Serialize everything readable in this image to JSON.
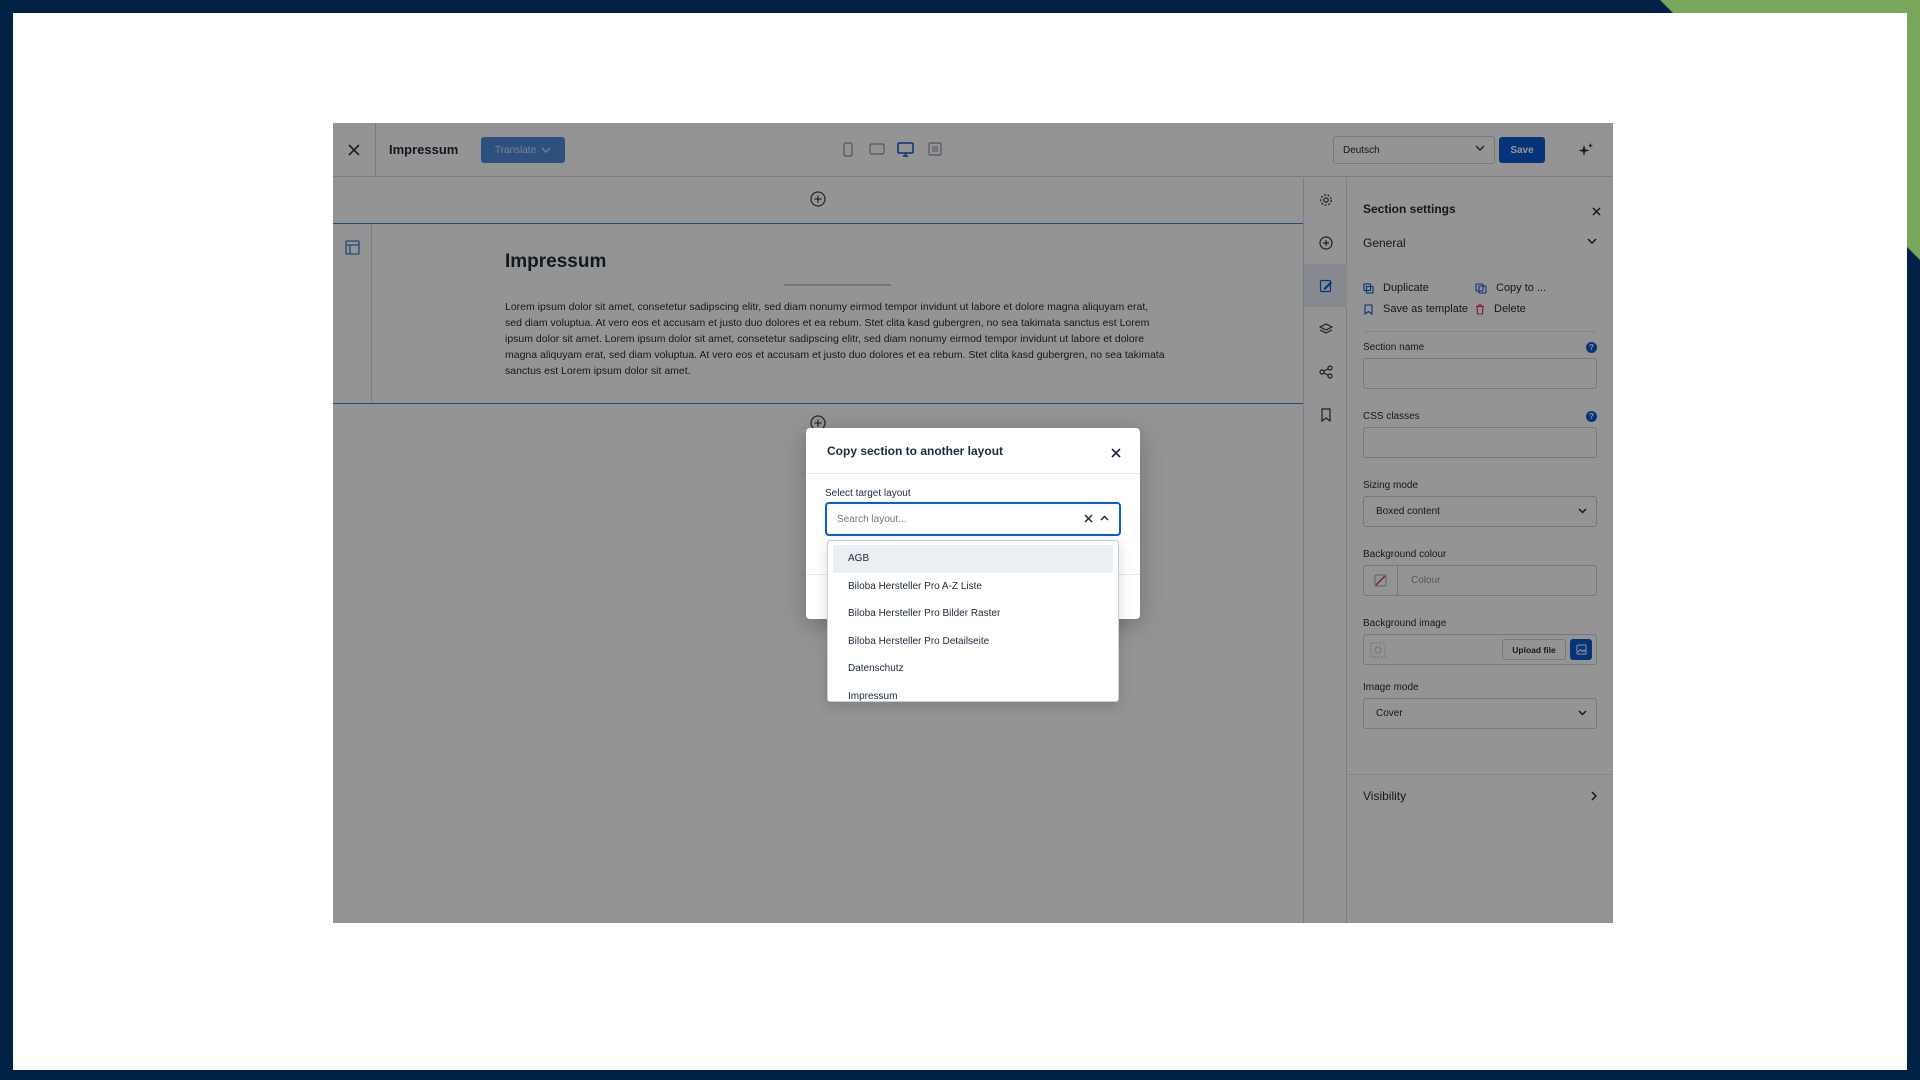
{
  "topbar": {
    "page_title": "Impressum",
    "translate_label": "Translate",
    "language": "Deutsch",
    "save_label": "Save"
  },
  "canvas": {
    "heading": "Impressum",
    "body": "Lorem ipsum dolor sit amet, consetetur sadipscing elitr, sed diam nonumy eirmod tempor invidunt ut labore et dolore magna aliquyam erat, sed diam voluptua. At vero eos et accusam et justo duo dolores et ea rebum. Stet clita kasd gubergren, no sea takimata sanctus est Lorem ipsum dolor sit amet. Lorem ipsum dolor sit amet, consetetur sadipscing elitr, sed diam nonumy eirmod tempor invidunt ut labore et dolore magna aliquyam erat, sed diam voluptua. At vero eos et accusam et justo duo dolores et ea rebum. Stet clita kasd gubergren, no sea takimata sanctus est Lorem ipsum dolor sit amet."
  },
  "panel": {
    "title": "Section settings",
    "general_label": "General",
    "actions": {
      "duplicate": "Duplicate",
      "copy_to": "Copy to ...",
      "save_as_template": "Save as template",
      "delete": "Delete"
    },
    "section_name_label": "Section name",
    "css_classes_label": "CSS classes",
    "sizing_mode_label": "Sizing mode",
    "sizing_mode_value": "Boxed content",
    "background_colour_label": "Background colour",
    "colour_placeholder": "Colour",
    "background_image_label": "Background image",
    "upload_label": "Upload file",
    "image_mode_label": "Image mode",
    "image_mode_value": "Cover",
    "visibility_label": "Visibility"
  },
  "modal": {
    "title": "Copy section to another layout",
    "select_label": "Select target layout",
    "search_placeholder": "Search layout...",
    "options": [
      "AGB",
      "Biloba Hersteller Pro A-Z Liste",
      "Biloba Hersteller Pro Bilder Raster",
      "Biloba Hersteller Pro Detailseite",
      "Datenschutz",
      "Impressum"
    ]
  },
  "colors": {
    "accent": "#0b5bd3",
    "frame_bg": "#012345",
    "corner": "#7aa75a"
  }
}
